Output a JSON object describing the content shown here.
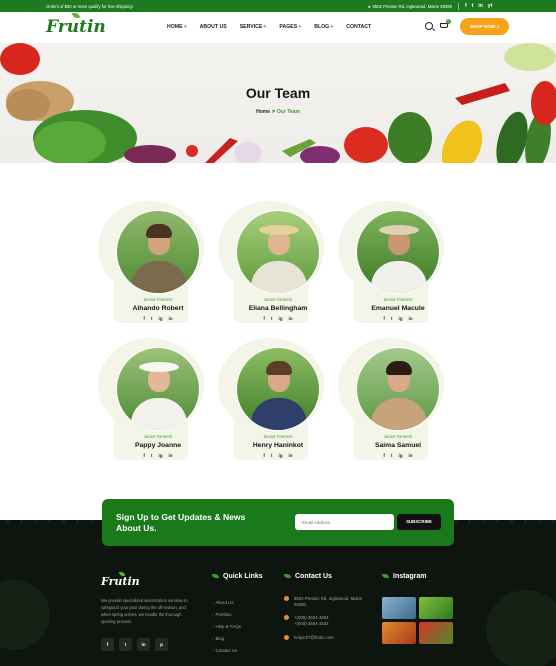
{
  "topbar": {
    "promo": "Orders of $50 or more qualify for free shipping!",
    "address": "8502 Preston Rd. Inglewood, Maine 98380",
    "socials": [
      "f",
      "t",
      "in",
      "yt"
    ]
  },
  "header": {
    "logo": "Frutin",
    "nav": [
      "HOME",
      "ABOUT US",
      "SERVICE",
      "PAGES",
      "BLOG",
      "CONTACT"
    ],
    "nav_plus": [
      "+",
      "",
      "+",
      "+",
      "+",
      ""
    ],
    "cart_count": "0",
    "shop_button": "SHOP NOW »"
  },
  "hero": {
    "title": "Our Team",
    "breadcrumb_home": "Home",
    "breadcrumb_sep": ">",
    "breadcrumb_current": "Our Team"
  },
  "team": [
    {
      "role": "Senior Farmers",
      "name": "Alhando Robert"
    },
    {
      "role": "Junior Farmers",
      "name": "Eliana Bellingham"
    },
    {
      "role": "Senior Farmers",
      "name": "Emanuel Macule"
    },
    {
      "role": "Junior Farmers",
      "name": "Pappy Joanne"
    },
    {
      "role": "Senior Farmers",
      "name": "Henry Haninkot"
    },
    {
      "role": "Junior Farmers",
      "name": "Saima Samuel"
    }
  ],
  "card_socials": [
    "f",
    "t",
    "ig",
    "in"
  ],
  "newsletter": {
    "title": "Sign Up to Get Updates & News About Us.",
    "placeholder": "Email Address",
    "button": "SUBSCRIBE"
  },
  "footer": {
    "logo": "Frutin",
    "description": "We provide specialized winterization services to safeguard your pool during the off-season, and when spring arrives, we handle the thorough opening process.",
    "socials": [
      "f",
      "t",
      "in",
      "p"
    ],
    "quick_links_title": "Quick Links",
    "quick_links": [
      "About Us",
      "Portfolio",
      "Help & FAQs",
      "Blog",
      "Contact Us"
    ],
    "contact_title": "Contact Us",
    "contact_address": "8502 Preston Rd. Inglewood, Maine 98380",
    "contact_phone_1": "+(000)-3654-3654",
    "contact_phone_2": "+(000)-3654-3432",
    "contact_email": "help24/7@frutin.com",
    "instagram_title": "Instagram"
  },
  "colors": {
    "brand_green": "#1e7a1e",
    "accent_orange": "#f7a21b",
    "footer_bg": "#0e150e"
  }
}
